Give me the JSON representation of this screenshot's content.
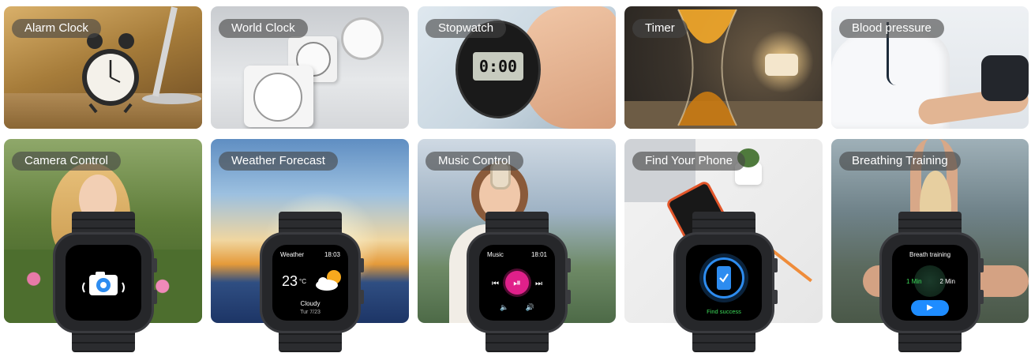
{
  "tiles": [
    {
      "label": "Alarm Clock"
    },
    {
      "label": "World Clock"
    },
    {
      "label": "Stopwatch"
    },
    {
      "label": "Timer"
    },
    {
      "label": "Blood pressure"
    },
    {
      "label": "Camera Control"
    },
    {
      "label": "Weather Forecast"
    },
    {
      "label": "Music Control"
    },
    {
      "label": "Find Your Phone"
    },
    {
      "label": "Breathing Training"
    }
  ],
  "watch_weather": {
    "title": "Weather",
    "time": "18:03",
    "temp": "23",
    "unit": "°C",
    "condition": "Cloudy",
    "date": "Tur 7/23"
  },
  "watch_music": {
    "title": "Music",
    "time": "18:01"
  },
  "watch_phone": {
    "status": "Find success"
  },
  "watch_breath": {
    "title": "Breath training",
    "opt1": "1 Min",
    "opt2": "2 Min"
  },
  "stopwatch_display": "0:00",
  "colors": {
    "accent_green": "#3ddc5a",
    "music_pink": "#e0208a",
    "breath_blue": "#1e8cff",
    "phone_blue": "#2d8cf0"
  }
}
